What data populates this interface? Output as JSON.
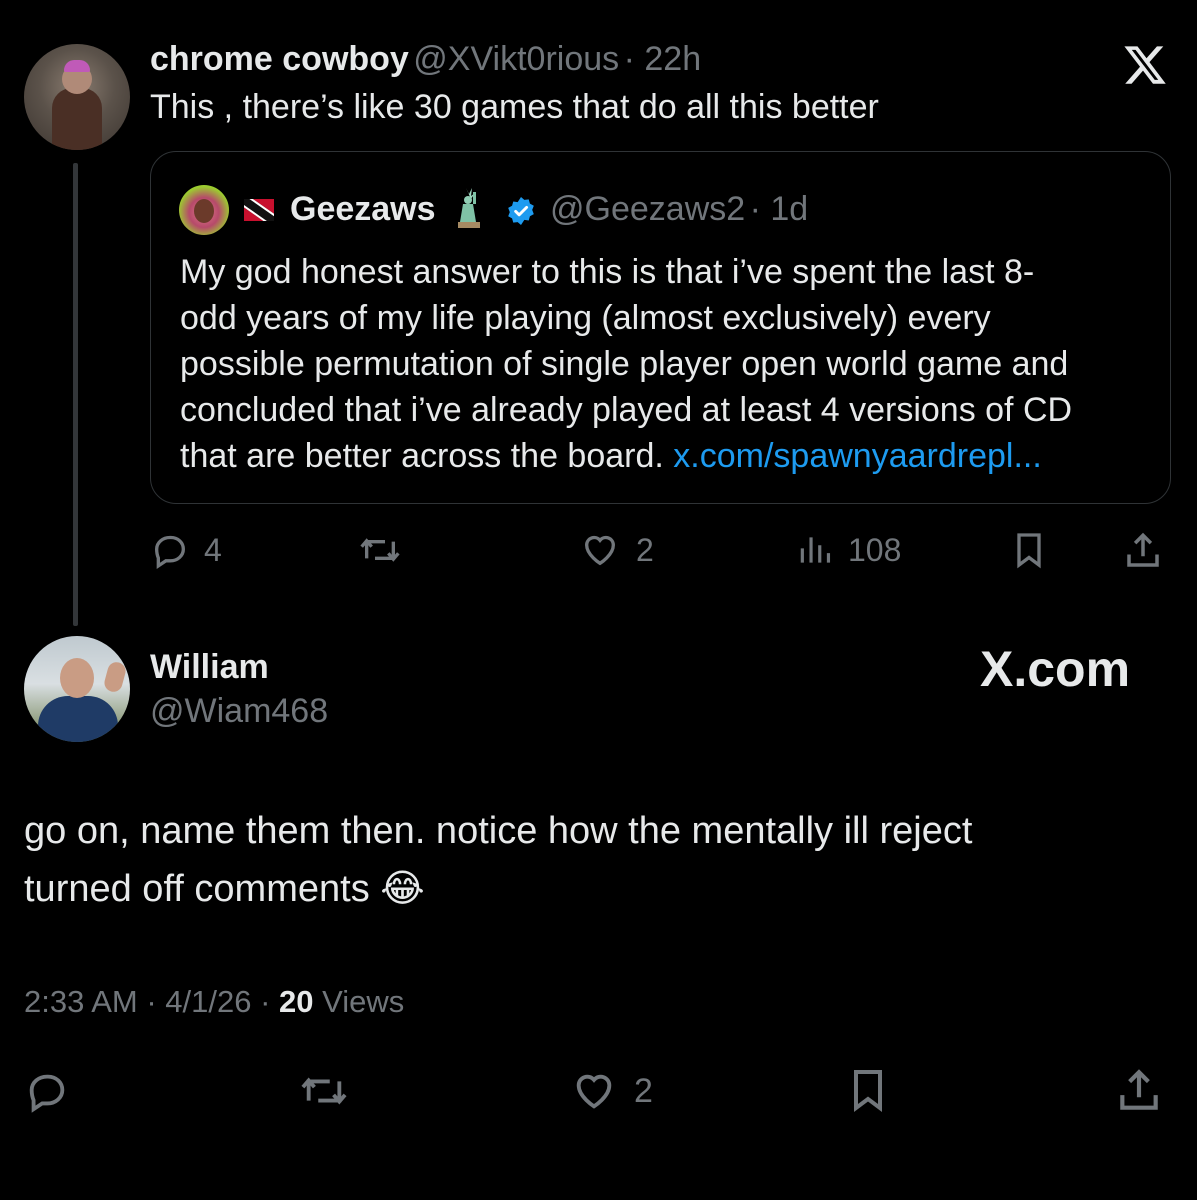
{
  "reply": {
    "author_name": "chrome cowboy",
    "author_handle": "@XVikt0rious",
    "time": "· 22h",
    "text": "This , there’s like 30 games that do all this better",
    "stats": {
      "replies": "4",
      "reposts": "",
      "likes": "2",
      "views": "108"
    }
  },
  "quoted": {
    "author_name": "Geezaws",
    "author_handle": "@Geezaws2",
    "time": "· 1d",
    "text_lines": [
      "My god honest answer to this is that i’ve spent the last 8-",
      "odd years of my life playing (almost exclusively) every",
      "possible permutation of single player open world game and",
      "concluded that i’ve already played at least 4 versions of CD",
      "that are better across the board."
    ],
    "link": "x.com/spawnyaardrepl..."
  },
  "main": {
    "author_name": "William",
    "author_handle": "@Wiam468",
    "watermark": "X.com",
    "text_line1": "go on, name them then. notice how the mentally ill reject",
    "text_line2": "turned off comments",
    "emoji": "😂",
    "timestamp": "2:33 AM · 4/1/26 ·",
    "views_count": "20",
    "views_label": "Views",
    "likes": "2"
  },
  "icons": {
    "close": "x-logo-icon",
    "reply": "reply-bubble-icon",
    "repost": "repost-icon",
    "like": "heart-icon",
    "views": "bar-chart-icon",
    "bookmark": "bookmark-icon",
    "share": "share-icon",
    "verified": "verified-badge-icon",
    "statue": "statue-of-liberty-icon",
    "flag": "trinidad-flag-icon"
  },
  "colors": {
    "background": "#000000",
    "text": "#e7e9ea",
    "muted": "#71767b",
    "link": "#1d9bf0",
    "verified": "#1d9bf0"
  }
}
